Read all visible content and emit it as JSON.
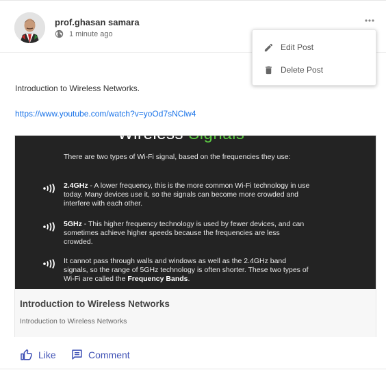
{
  "post": {
    "author": "prof.ghasan samara",
    "timestamp": "1 minute ago",
    "privacy_icon": "globe-icon",
    "text": "Introduction to Wireless Networks.",
    "link": "https://www.youtube.com/watch?v=yoOd7sNClw4"
  },
  "menu": {
    "edit_label": "Edit Post",
    "delete_label": "Delete Post"
  },
  "preview": {
    "slide_title_white": "Wireless",
    "slide_title_green": "Signals",
    "intro": "There are two types of Wi-Fi signal, based on the frequencies they use:",
    "item1_bold": "2.4GHz",
    "item1_text": " - A lower frequency, this is the more common Wi-Fi technology in use today. Many devices use it, so the signals can become more crowded and interfere with each other.",
    "item2_bold": "5GHz",
    "item2_text": " - This higher frequency technology is used by fewer devices, and can sometimes achieve higher speeds because the frequencies are less crowded.",
    "item3_text": "It cannot pass through walls and windows as well as the 2.4GHz band signals, so the range of 5GHz technology is often shorter. These two types of Wi-Fi are called the ",
    "item3_bold": "Frequency Bands",
    "item3_end": ".",
    "title": "Introduction to Wireless Networks",
    "subtitle": "Introduction to Wireless Networks"
  },
  "actions": {
    "like_label": "Like",
    "comment_label": "Comment"
  },
  "colors": {
    "link": "#1a73e8",
    "action": "#3f51b5",
    "slide_green": "#5cc843"
  }
}
